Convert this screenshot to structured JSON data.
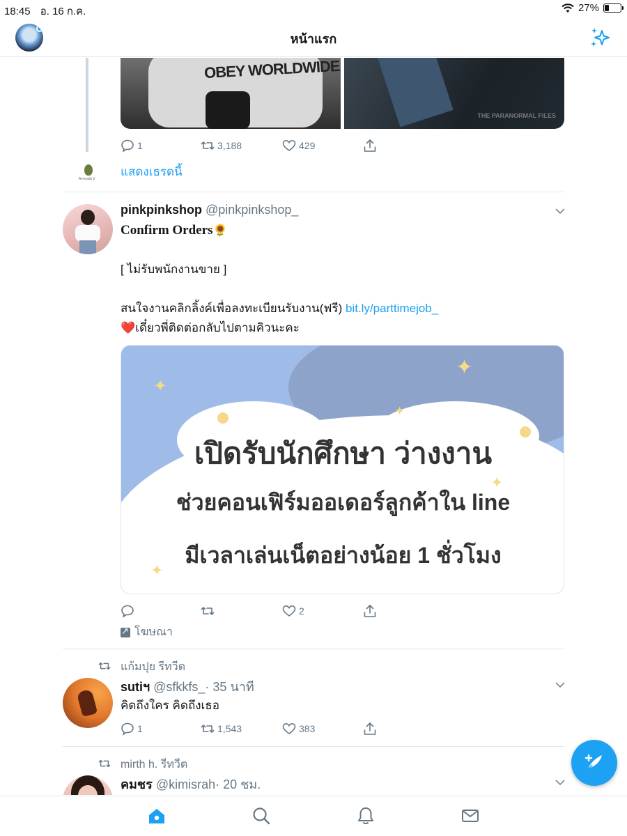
{
  "status_bar": {
    "time": "18:45",
    "date": "อ. 16 ก.ค.",
    "battery": "27%",
    "battery_level": 0.27
  },
  "header": {
    "title": "หน้าแรก"
  },
  "thread_tweet": {
    "image_text": "OBEY WORLDWIDE",
    "watermark": "THE PARANORMAL FILES",
    "replies": "1",
    "retweets": "3,188",
    "likes": "429",
    "show_thread": "แสดงเธรดนี้",
    "avatar_tag": "Avocado ji"
  },
  "ad_tweet": {
    "name": "pinkpinkshop",
    "handle": "@pinkpinkshop_",
    "line1": "Confirm Orders",
    "line1_emoji": "🌻",
    "line2": "[ ไม่รับพนักงานขาย ]",
    "line3": "สนใจงานคลิกลิ้งค์เพื่อลงทะเบียนรับงาน(ฟรี)",
    "link": "bit.ly/parttimejob_",
    "line4_emoji": "❤️",
    "line4": "เดี๋ยวพี่ติดต่อกลับไปตามคิวนะคะ",
    "image_lines": [
      "เปิดรับนักศึกษา ว่างงาน",
      "ช่วยคอนเฟิร์มออเดอร์ลูกค้าใน line",
      "มีเวลาเล่นเน็ตอย่างน้อย 1 ชั่วโมง"
    ],
    "replies": "",
    "retweets": "",
    "likes": "2",
    "promoted": "โฆษณา"
  },
  "tweet3": {
    "retweeted_by": "แก้มปุย รีทวีต",
    "name": "sutiฯ",
    "handle": "@sfkkfs_",
    "time": "· 35 นาที",
    "text": "คิดถึงใคร คิดถึงเธอ",
    "replies": "1",
    "retweets": "1,543",
    "likes": "383"
  },
  "tweet4": {
    "retweeted_by": "mirth h. รีทวีต",
    "name": "คมชร",
    "handle": "@kimisrah",
    "time": "· 20 ชม."
  },
  "tabs": [
    "home",
    "search",
    "notifications",
    "messages"
  ]
}
